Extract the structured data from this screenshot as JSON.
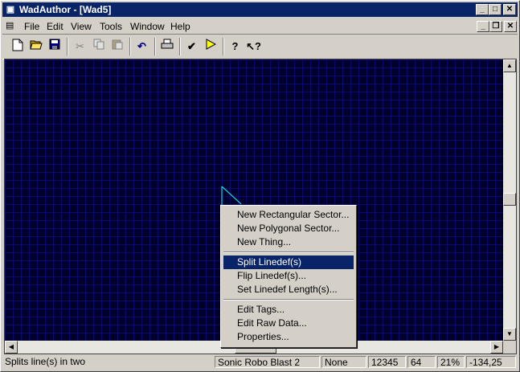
{
  "window": {
    "title": "WadAuthor - [Wad5]"
  },
  "menu": {
    "items": [
      "File",
      "Edit",
      "View",
      "Tools",
      "Window",
      "Help"
    ]
  },
  "toolbar": {
    "buttons": [
      "new-icon",
      "open-icon",
      "save-icon",
      "cut-icon",
      "copy-icon",
      "paste-icon",
      "undo-icon",
      "print-icon",
      "check-icon",
      "run-icon",
      "help-icon",
      "context-help-icon"
    ]
  },
  "context_menu": {
    "items": [
      "New Rectangular Sector...",
      "New Polygonal Sector...",
      "New Thing...",
      "Split Linedef(s)",
      "Flip Linedef(s)...",
      "Set Linedef Length(s)...",
      "Edit Tags...",
      "Edit Raw Data...",
      "Properties..."
    ],
    "selected": "Split Linedef(s)"
  },
  "status": {
    "message": "Splits line(s) in two",
    "game": "Sonic Robo Blast 2",
    "mode": "None",
    "count": "12345",
    "grid": "64",
    "zoom": "21%",
    "coords": "-134,25"
  },
  "colors": {
    "canvas_bg": "#00002a",
    "grid": "#0a0a6e",
    "highlight": "#0a246a",
    "linedef": "#00ffff"
  }
}
